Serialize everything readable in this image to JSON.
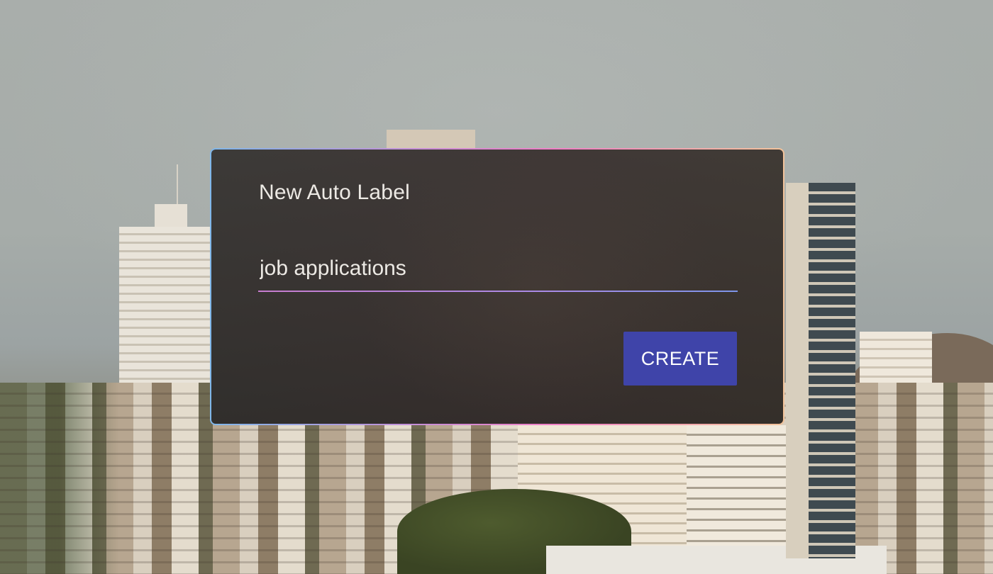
{
  "dialog": {
    "title": "New Auto Label",
    "input_value": "job applications",
    "create_label": "CREATE"
  },
  "colors": {
    "button": "#3f44a9",
    "dialog_bg": "#3a3632",
    "border_gradient": [
      "#7fb7ea",
      "#c48fd8",
      "#f07fc6",
      "#f2c39a"
    ],
    "underline_gradient": [
      "#c77dcf",
      "#7d94e8"
    ]
  }
}
